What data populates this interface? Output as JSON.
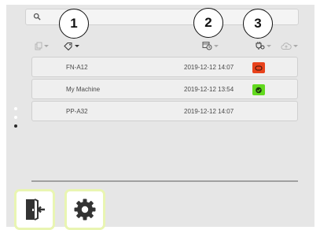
{
  "colors": {
    "panel": "#e6e6e6",
    "status_error": "#e8421c",
    "status_ok": "#62d91e",
    "button_border": "#e9f5b2"
  },
  "search": {
    "placeholder": "",
    "icon": "search-icon"
  },
  "callouts": [
    "1",
    "2",
    "3"
  ],
  "toolbar": {
    "icons": [
      "copy-icon",
      "tag-icon",
      "calendar-clock-icon",
      "connection-icon",
      "cloud-upload-icon"
    ]
  },
  "machines": [
    {
      "name": "FN-A12",
      "date": "2019-12-12 14:07",
      "status": "error"
    },
    {
      "name": "My Machine",
      "date": "2019-12-12 13:54",
      "status": "ok"
    },
    {
      "name": "PP-A32",
      "date": "2019-12-12 14:07",
      "status": "none"
    }
  ],
  "pager": {
    "pages": 3,
    "current": 3
  },
  "actions": [
    {
      "name": "logout-button",
      "icon": "logout-door-icon"
    },
    {
      "name": "settings-button",
      "icon": "gear-icon"
    }
  ]
}
